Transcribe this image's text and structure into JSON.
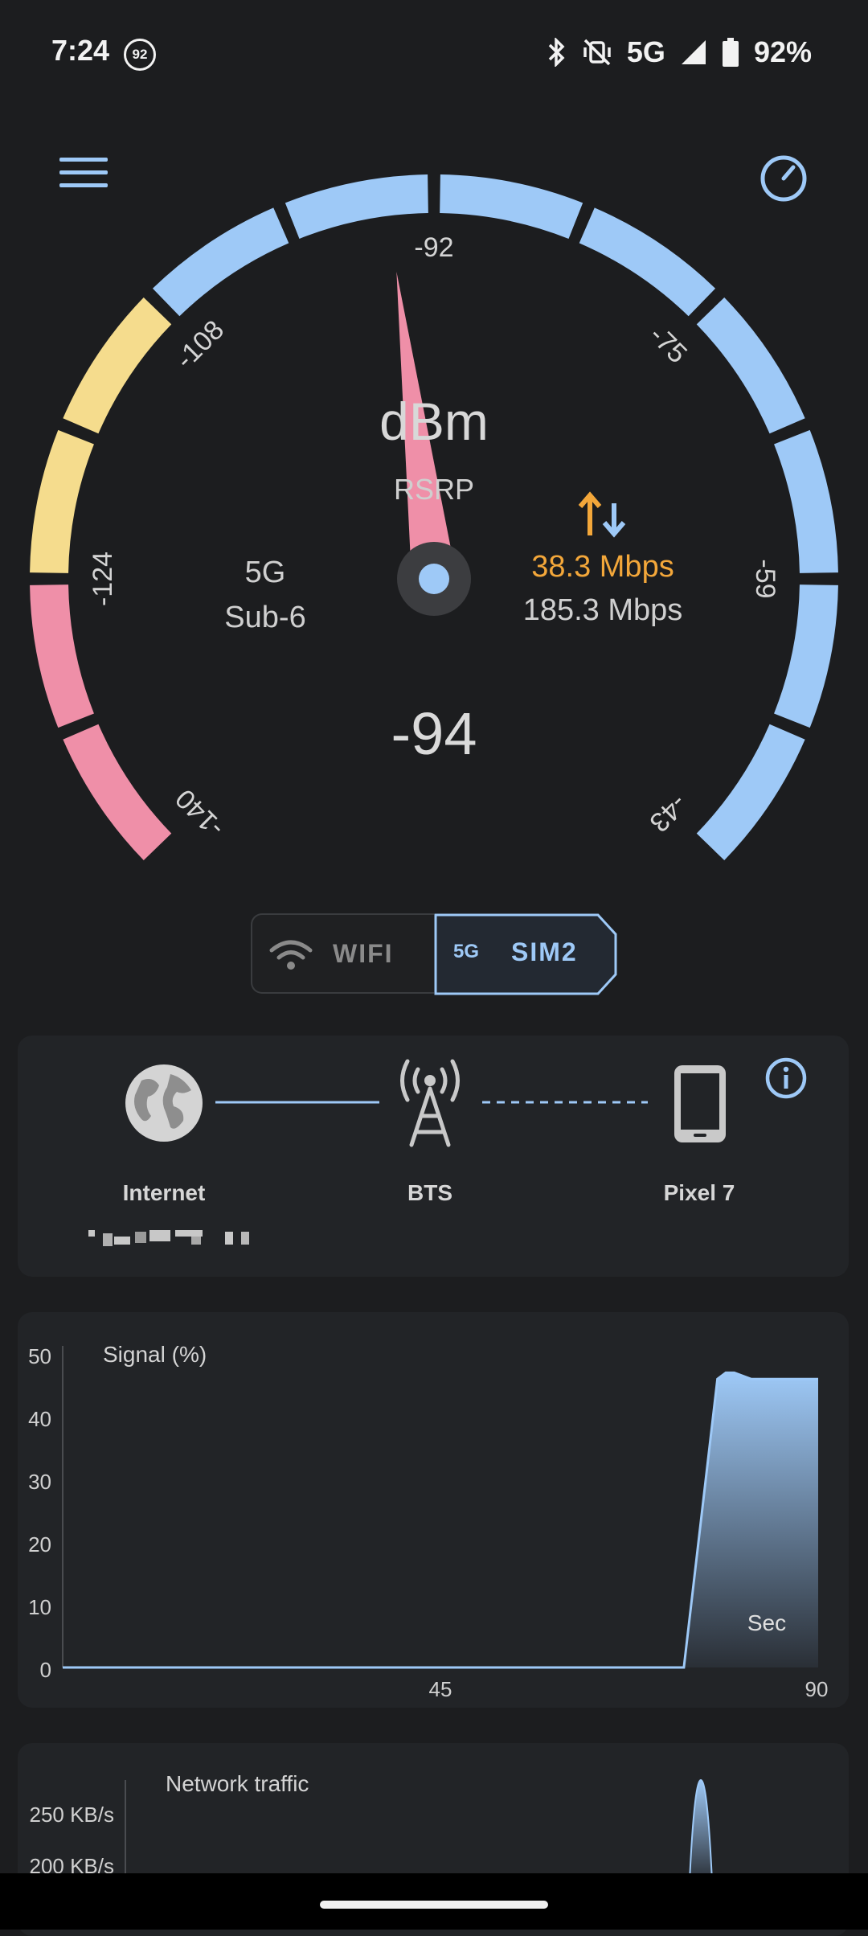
{
  "status_bar": {
    "time": "7:24",
    "notification_badge": "92",
    "network": "5G",
    "battery": "92%",
    "icons": [
      "bluetooth-icon",
      "vibrate-off-icon",
      "signal-bars-icon",
      "battery-icon"
    ]
  },
  "gauge": {
    "scale_labels": [
      "-140",
      "-124",
      "-108",
      "-92",
      "-75",
      "-59",
      "-43"
    ],
    "unit": "dBm",
    "mode": "RSRP",
    "network_type": "5G",
    "band": "Sub-6",
    "upload": "38.3 Mbps",
    "download": "185.3 Mbps",
    "value": "-94",
    "needle_value": -94,
    "colors": {
      "bad": "#ef8fa8",
      "fair": "#f5dc8d",
      "good": "#9ec9f7",
      "upload": "#f3a73a"
    }
  },
  "toggle": {
    "wifi_label": "WIFI",
    "sim_tag": "5G",
    "sim_label": "SIM2"
  },
  "connection": {
    "nodes": [
      "Internet",
      "BTS",
      "Pixel 7"
    ]
  },
  "chart_data": [
    {
      "type": "area",
      "title": "Signal (%)",
      "x_label": "Sec",
      "x_ticks": [
        "45",
        "90"
      ],
      "y_ticks": [
        "0",
        "10",
        "20",
        "30",
        "40",
        "50"
      ],
      "xlim": [
        0,
        90
      ],
      "ylim": [
        0,
        50
      ],
      "series": [
        {
          "x": [
            0,
            72,
            74,
            78,
            79,
            80,
            82,
            84,
            90
          ],
          "y": [
            0,
            0,
            0,
            46,
            47,
            47,
            46,
            46,
            46
          ]
        }
      ]
    },
    {
      "type": "area",
      "title": "Network traffic",
      "y_ticks": [
        "250 KB/s",
        "200 KB/s"
      ]
    }
  ]
}
